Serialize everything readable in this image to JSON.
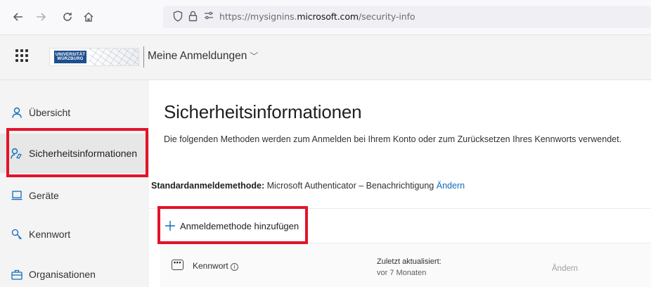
{
  "browser": {
    "url_prefix": "https://mysignins.",
    "url_host": "microsoft.com",
    "url_path": "/security-info"
  },
  "header": {
    "logo_text": "UNIVERSITÄT WÜRZBURG",
    "app_title": "Meine Anmeldungen"
  },
  "sidebar": {
    "items": [
      {
        "label": "Übersicht",
        "icon": "person-icon"
      },
      {
        "label": "Sicherheitsinformationen",
        "icon": "security-info-icon",
        "active": true
      },
      {
        "label": "Geräte",
        "icon": "laptop-icon"
      },
      {
        "label": "Kennwort",
        "icon": "key-icon"
      },
      {
        "label": "Organisationen",
        "icon": "briefcase-icon"
      }
    ]
  },
  "main": {
    "title": "Sicherheitsinformationen",
    "description": "Die folgenden Methoden werden zum Anmelden bei Ihrem Konto oder zum Zurücksetzen Ihres Kennworts verwendet.",
    "default_method_label": "Standardanmeldemethode:",
    "default_method_value": "Microsoft Authenticator – Benachrichtigung",
    "default_method_change": "Ändern",
    "add_method_label": "Anmeldemethode hinzufügen",
    "methods": [
      {
        "name": "Kennwort",
        "updated_label": "Zuletzt aktualisiert:",
        "updated_value": "vor 7 Monaten",
        "action": "Ändern"
      }
    ]
  },
  "colors": {
    "accent": "#0f6cbd",
    "highlight_box": "#e3132a"
  }
}
